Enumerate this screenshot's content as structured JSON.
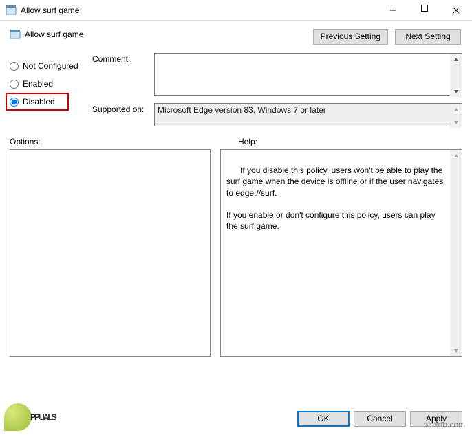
{
  "window": {
    "title": "Allow surf game"
  },
  "header": {
    "title": "Allow surf game",
    "prev_label": "Previous Setting",
    "next_label": "Next Setting"
  },
  "state": {
    "not_configured": "Not Configured",
    "enabled": "Enabled",
    "disabled": "Disabled",
    "selected": "disabled"
  },
  "fields": {
    "comment_label": "Comment:",
    "comment_value": "",
    "supported_label": "Supported on:",
    "supported_value": "Microsoft Edge version 83, Windows 7 or later"
  },
  "panes": {
    "options_label": "Options:",
    "help_label": "Help:",
    "help_text": "If you disable this policy, users won't be able to play the surf game when the device is offline or if the user navigates to edge://surf.\n\nIf you enable or don't configure this policy, users can play the surf game."
  },
  "footer": {
    "ok": "OK",
    "cancel": "Cancel",
    "apply": "Apply"
  },
  "watermark": {
    "logo_text": "PPUALS",
    "site": "wsxdn.com"
  }
}
